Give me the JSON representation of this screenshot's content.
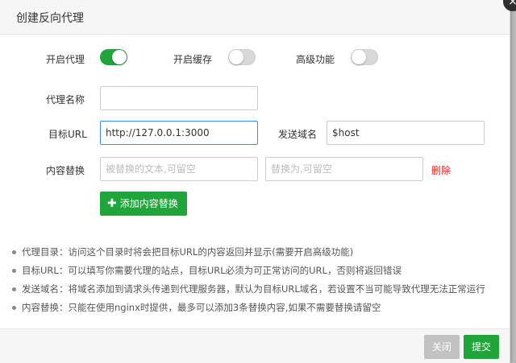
{
  "dialog": {
    "title": "创建反向代理",
    "close_glyph": "×"
  },
  "toggles": [
    {
      "label": "开启代理",
      "on": true
    },
    {
      "label": "开启缓存",
      "on": false
    },
    {
      "label": "高级功能",
      "on": false
    }
  ],
  "form": {
    "proxy_name": {
      "label": "代理名称",
      "value": "",
      "placeholder": ""
    },
    "target_url": {
      "label": "目标URL",
      "value": "http://127.0.0.1:3000"
    },
    "send_domain": {
      "label": "发送域名",
      "value": "$host"
    },
    "content_replace": {
      "label": "内容替换",
      "from_placeholder": "被替换的文本,可留空",
      "to_placeholder": "替换为,可留空",
      "delete_label": "删除"
    },
    "add_replace_button": "添加内容替换"
  },
  "notes": [
    "代理目录：访问这个目录时将会把目标URL的内容返回并显示(需要开启高级功能)",
    "目标URL：可以填写你需要代理的站点，目标URL必须为可正常访问的URL，否则将返回错误",
    "发送域名：将域名添加到请求头传递到代理服务器，默认为目标URL域名，若设置不当可能导致代理无法正常运行",
    "内容替换：只能在使用nginx时提供，最多可以添加3条替换内容,如果不需要替换请留空"
  ],
  "footer": {
    "close_label": "关闭",
    "submit_label": "提交"
  },
  "colors": {
    "accent": "#20a53a",
    "delete": "#e8251f",
    "disabled": "#c2c2c2",
    "focus": "#3d8fd5"
  }
}
